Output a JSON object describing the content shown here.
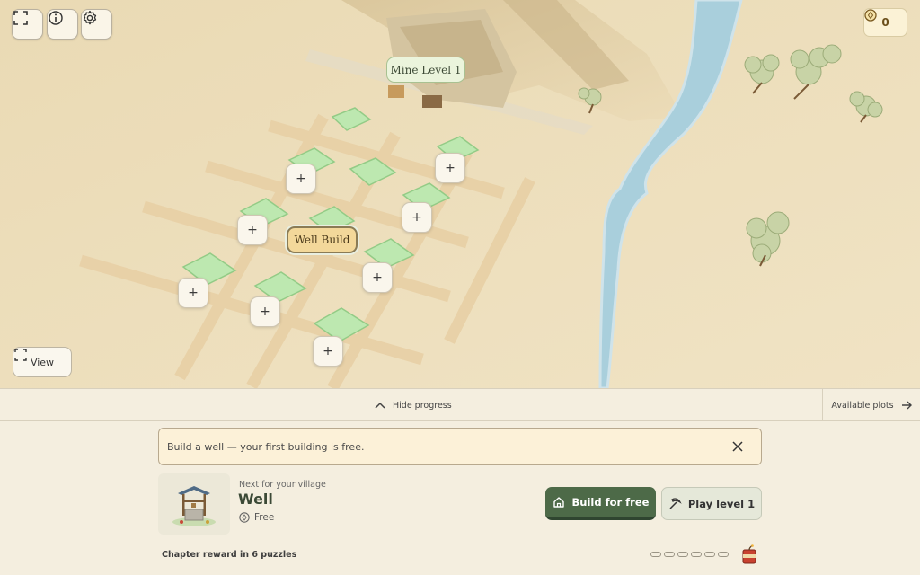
{
  "top_controls": {
    "fullscreen_icon": "fullscreen-icon",
    "info_icon": "info-icon",
    "settings_icon": "gear-icon"
  },
  "currency": {
    "count": "0",
    "icon": "coin-icon",
    "color": "#6b4f1a"
  },
  "map": {
    "mine_label": "Mine Level 1",
    "well_label": "Well Build",
    "plot_button_label": "+",
    "view_button_label": "View",
    "colors": {
      "sand": "#eddfbe",
      "river": "#a9cfdc",
      "plot": "#bde8b0"
    }
  },
  "progress_bar": {
    "hide_label": "Hide progress",
    "available_plots_label": "Available plots"
  },
  "notice": {
    "text": "Build a well — your first building is free."
  },
  "next_building": {
    "subtitle": "Next for your village",
    "name": "Well",
    "price": "Free"
  },
  "actions": {
    "build_label": "Build for free",
    "play_label": "Play level 1",
    "primary_color": "#4d6a48"
  },
  "chapter": {
    "reward_text": "Chapter reward in 6 puzzles",
    "total_puzzles": 6,
    "completed_puzzles": 0,
    "reward_icon": "tnt-icon"
  }
}
